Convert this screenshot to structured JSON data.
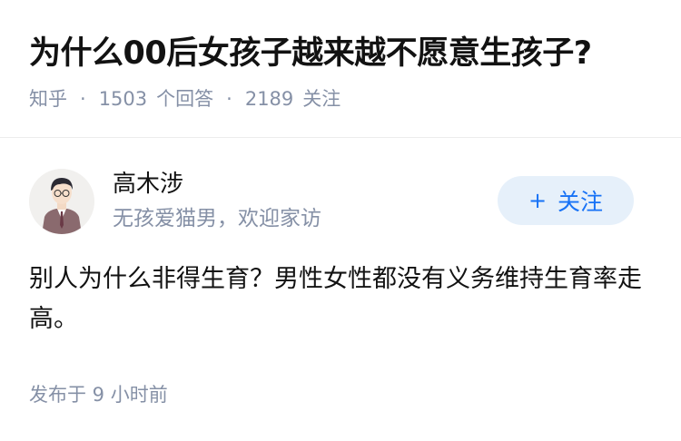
{
  "question": {
    "title": "为什么00后女孩子越来越不愿意生孩子?",
    "source": "知乎",
    "separator": "·",
    "answer_count": "1503",
    "answer_label": "个回答",
    "follower_count": "2189",
    "follower_label": "关注"
  },
  "author": {
    "name": "高木涉",
    "bio": "无孩爱猫男，欢迎家访",
    "avatar_icon": "person-avatar-icon"
  },
  "follow_button": {
    "icon": "+",
    "label": "关注"
  },
  "answer": {
    "content": "别人为什么非得生育？男性女性都没有义务维持生育率走高。",
    "published": "发布于  9 小时前"
  },
  "colors": {
    "primary": "#1772f6",
    "follow_bg": "#e6f0fa",
    "meta_text": "#8590a6",
    "title_text": "#121212"
  }
}
